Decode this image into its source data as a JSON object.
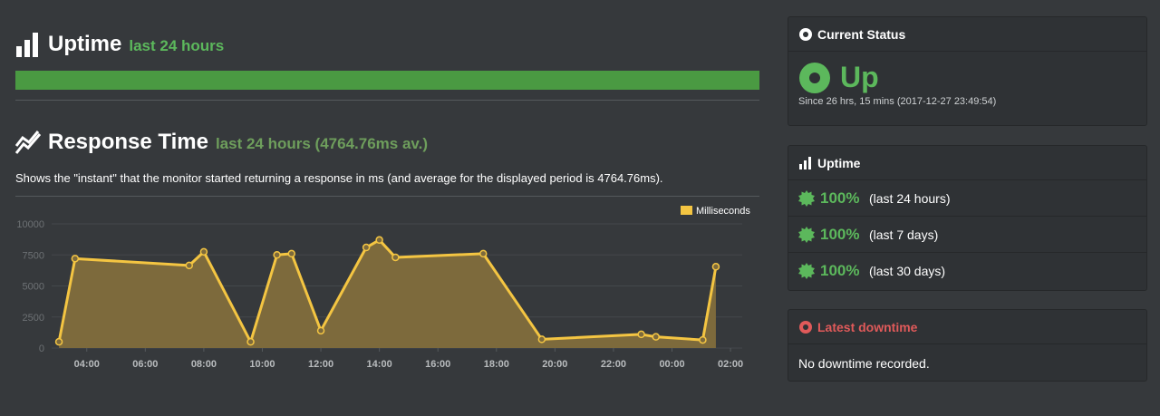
{
  "uptime_section": {
    "title": "Uptime",
    "subtitle": "last 24 hours",
    "bar_fraction": 1.0,
    "bar_color": "#4a9a42",
    "icon": "bar-chart-icon"
  },
  "response_section": {
    "title": "Response Time",
    "subtitle": "last 24 hours (4764.76ms av.)",
    "description": "Shows the \"instant\" that the monitor started returning a response in ms (and average for the displayed period is 4764.76ms).",
    "icon": "line-chart-icon"
  },
  "chart_data": {
    "type": "area",
    "legend": [
      "Milliseconds"
    ],
    "legend_position": "top-right",
    "y_ticks": [
      "0",
      "2500",
      "5000",
      "7500",
      "10000"
    ],
    "ylim": [
      0,
      10000
    ],
    "x_ticks": [
      "04:00",
      "06:00",
      "08:00",
      "10:00",
      "12:00",
      "14:00",
      "16:00",
      "18:00",
      "20:00",
      "22:00",
      "00:00",
      "02:00"
    ],
    "x_start_hour": 2.8,
    "x_end_hour": 26.4,
    "series": [
      {
        "name": "Milliseconds",
        "color": "#f4c542",
        "fill": "#7d6a3c",
        "points": [
          {
            "h": 3.05,
            "v": 500
          },
          {
            "h": 3.6,
            "v": 7200
          },
          {
            "h": 7.5,
            "v": 6650
          },
          {
            "h": 8.0,
            "v": 7750
          },
          {
            "h": 9.6,
            "v": 500
          },
          {
            "h": 10.5,
            "v": 7500
          },
          {
            "h": 11.0,
            "v": 7600
          },
          {
            "h": 12.0,
            "v": 1400
          },
          {
            "h": 13.55,
            "v": 8100
          },
          {
            "h": 14.0,
            "v": 8700
          },
          {
            "h": 14.55,
            "v": 7300
          },
          {
            "h": 17.55,
            "v": 7600
          },
          {
            "h": 19.55,
            "v": 700
          },
          {
            "h": 22.95,
            "v": 1100
          },
          {
            "h": 23.45,
            "v": 900
          },
          {
            "h": 25.05,
            "v": 650
          },
          {
            "h": 25.5,
            "v": 6550
          }
        ]
      }
    ],
    "grid": true
  },
  "current_status": {
    "title": "Current Status",
    "state": "Up",
    "since": "Since 26 hrs, 15 mins (2017-12-27 23:49:54)",
    "color": "#5cb85c"
  },
  "uptime_panel": {
    "title": "Uptime",
    "rows": [
      {
        "pct": "100%",
        "range": "(last 24 hours)"
      },
      {
        "pct": "100%",
        "range": "(last 7 days)"
      },
      {
        "pct": "100%",
        "range": "(last 30 days)"
      }
    ]
  },
  "latest_downtime": {
    "title": "Latest downtime",
    "text": "No downtime recorded.",
    "color": "#e05a5a"
  }
}
